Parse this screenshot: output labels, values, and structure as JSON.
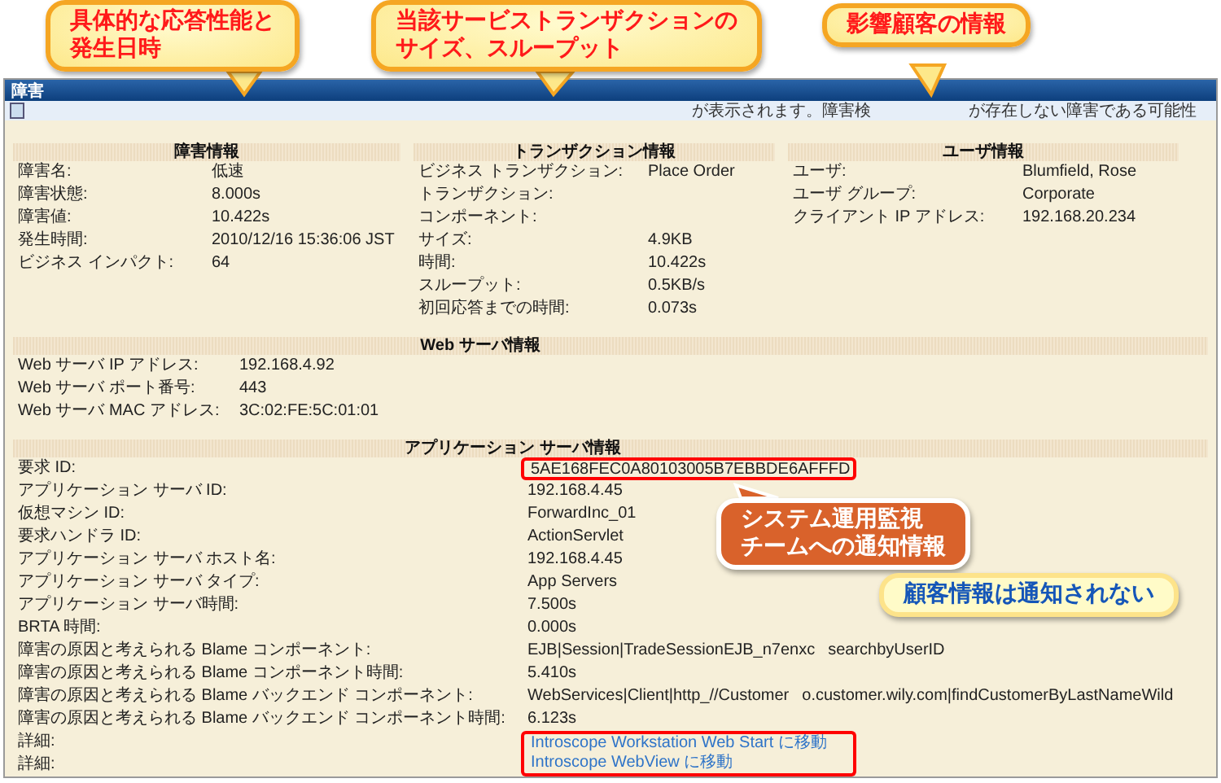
{
  "window": {
    "title": "障害",
    "message_parts": [
      "が表示されます。障害検",
      "が存在しない障害である可能性"
    ]
  },
  "top_sections": [
    {
      "title": "障害情報",
      "rows": [
        {
          "label": "障害名:",
          "value": "低速"
        },
        {
          "label": "障害状態:",
          "value": "8.000s"
        },
        {
          "label": "障害値:",
          "value": "10.422s"
        },
        {
          "label": "発生時間:",
          "value": "2010/12/16 15:36:06 JST"
        },
        {
          "label": "ビジネス インパクト:",
          "value": "64"
        }
      ]
    },
    {
      "title": "トランザクション情報",
      "rows": [
        {
          "label": "ビジネス トランザクション:",
          "value": "Place Order"
        },
        {
          "label": "トランザクション:",
          "value": ""
        },
        {
          "label": "コンポーネント:",
          "value": ""
        },
        {
          "label": "サイズ:",
          "value": "4.9KB"
        },
        {
          "label": "時間:",
          "value": "10.422s"
        },
        {
          "label": "スループット:",
          "value": "0.5KB/s"
        },
        {
          "label": "初回応答までの時間:",
          "value": "0.073s"
        }
      ]
    },
    {
      "title": "ユーザ情報",
      "rows": [
        {
          "label": "ユーザ:",
          "value": "Blumfield, Rose"
        },
        {
          "label": "ユーザ グループ:",
          "value": "Corporate"
        },
        {
          "label": "クライアント IP アドレス:",
          "value": "192.168.20.234"
        }
      ]
    }
  ],
  "sections": [
    {
      "title": "Web サーバ情報",
      "rows": [
        {
          "label": "Web サーバ IP アドレス:",
          "value": "192.168.4.92",
          "kind": "text",
          "framed": false
        },
        {
          "label": "Web サーバ ポート番号:",
          "value": "443",
          "kind": "text",
          "framed": false
        },
        {
          "label": "Web サーバ MAC アドレス:",
          "value": "3C:02:FE:5C:01:01",
          "kind": "text",
          "framed": false
        }
      ]
    },
    {
      "title": "アプリケーション サーバ情報",
      "rows": [
        {
          "label": "要求 ID:",
          "value": "5AE168FEC0A80103005B7EBBDE6AFFFD",
          "kind": "text",
          "framed": true
        },
        {
          "label": "アプリケーション サーバ ID:",
          "value": "192.168.4.45",
          "kind": "text",
          "framed": false
        },
        {
          "label": "仮想マシン ID:",
          "value": "ForwardInc_01",
          "kind": "text",
          "framed": false
        },
        {
          "label": "要求ハンドラ ID:",
          "value": "ActionServlet",
          "kind": "text",
          "framed": false
        },
        {
          "label": "アプリケーション サーバ ホスト名:",
          "value": "192.168.4.45",
          "kind": "text",
          "framed": false
        },
        {
          "label": "アプリケーション サーバ タイプ:",
          "value": "App Servers",
          "kind": "text",
          "framed": false
        },
        {
          "label": "アプリケーション サーバ時間:",
          "value": "7.500s",
          "kind": "text",
          "framed": false
        },
        {
          "label": "BRTA 時間:",
          "value": "0.000s",
          "kind": "text",
          "framed": false
        },
        {
          "label": "障害の原因と考えられる Blame コンポーネント:",
          "value": "EJB|Session|TradeSessionEJB_n7enxc",
          "value_tail": "searchbyUserID",
          "kind": "text",
          "framed": false
        },
        {
          "label": "障害の原因と考えられる Blame コンポーネント時間:",
          "value": "5.410s",
          "kind": "text",
          "framed": false
        },
        {
          "label": "障害の原因と考えられる Blame バックエンド コンポーネント:",
          "value": "WebServices|Client|http_//Customer",
          "value_tail": "o.customer.wily.com|findCustomerByLastNameWild",
          "kind": "text",
          "framed": false
        },
        {
          "label": "障害の原因と考えられる Blame バックエンド コンポーネント時間:",
          "value": "6.123s",
          "kind": "text",
          "framed": false
        },
        {
          "label": "詳細:",
          "value": "Introscope Workstation Web Start に移動",
          "kind": "link",
          "framed": true
        },
        {
          "label": "詳細:",
          "value": "Introscope WebView に移動",
          "kind": "link",
          "framed": true
        }
      ]
    }
  ],
  "callouts": [
    {
      "kind": "note",
      "lines": [
        "具体的な応答性能と",
        "発生日時"
      ]
    },
    {
      "kind": "note",
      "lines": [
        "当該サービストランザクションの",
        "サイズ、スループット"
      ]
    },
    {
      "kind": "note",
      "lines": [
        "影響顧客の情報"
      ]
    },
    {
      "kind": "alert",
      "lines": [
        "システム運用監視",
        "チームへの通知情報"
      ]
    },
    {
      "kind": "info",
      "lines": [
        "顧客情報は通知されない"
      ]
    }
  ]
}
